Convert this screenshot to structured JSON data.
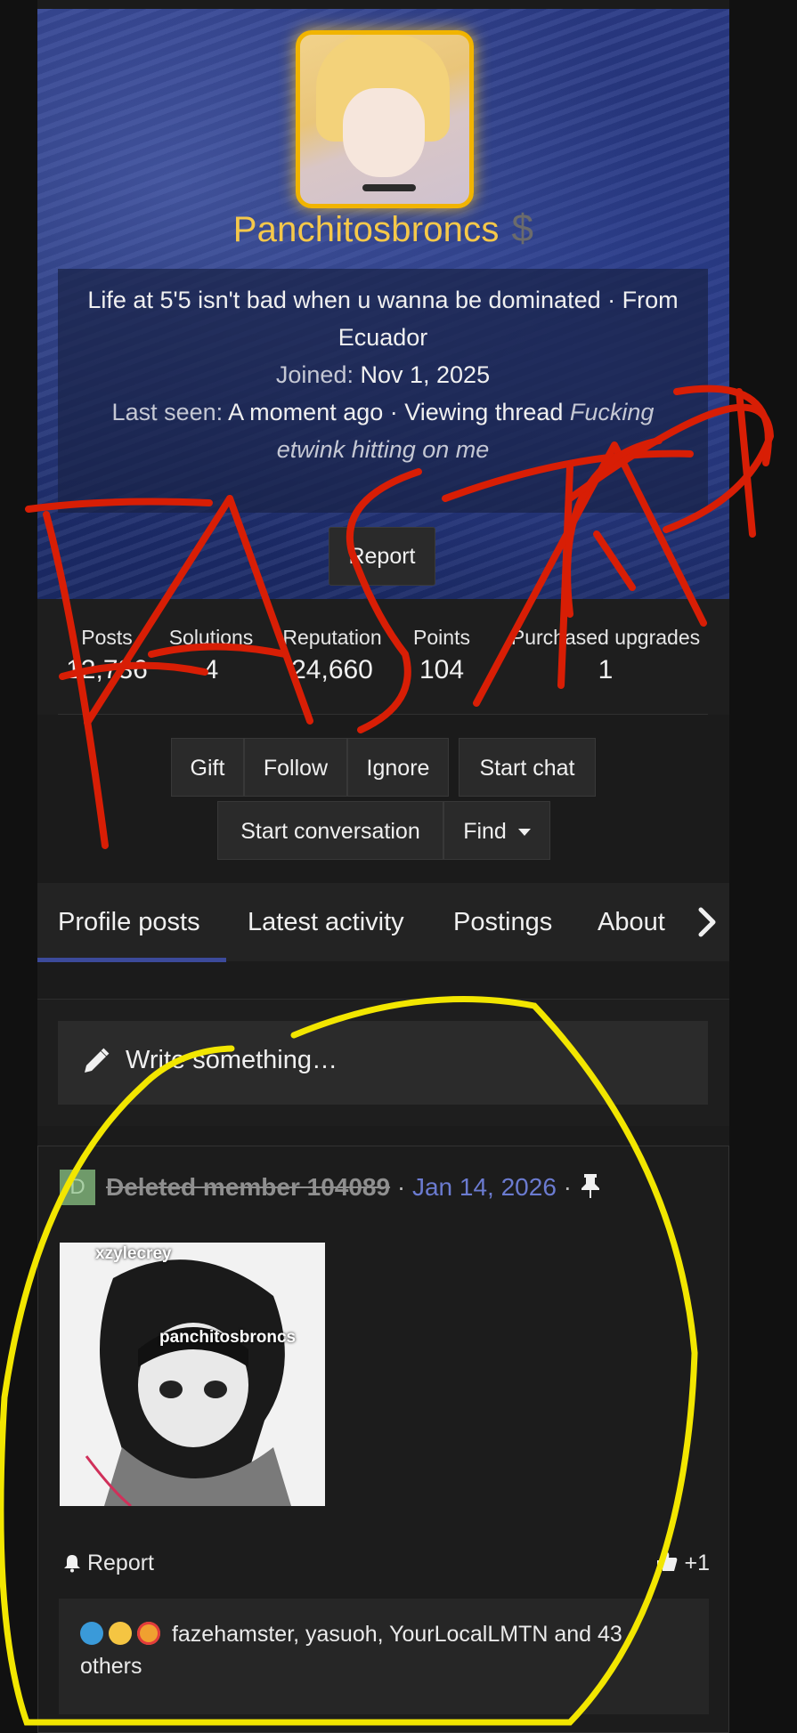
{
  "profile": {
    "username": "Panchitosbroncs",
    "badge_symbol": "$",
    "bio": "Life at 5'5 isn't bad when u wanna be dominated · From Ecuador",
    "joined_label": "Joined:",
    "joined_value": "Nov 1, 2025",
    "last_seen_label": "Last seen:",
    "last_seen_value": "A moment ago · Viewing thread",
    "last_seen_thread": "Fucking etwink hitting on me",
    "report_label": "Report"
  },
  "stats": [
    {
      "label": "Posts",
      "value": "12,736"
    },
    {
      "label": "Solutions",
      "value": "4"
    },
    {
      "label": "Reputation",
      "value": "24,660"
    },
    {
      "label": "Points",
      "value": "104"
    },
    {
      "label": "Purchased upgrades",
      "value": "1"
    }
  ],
  "actions": {
    "gift": "Gift",
    "follow": "Follow",
    "ignore": "Ignore",
    "start_chat": "Start chat",
    "start_conversation": "Start conversation",
    "find": "Find"
  },
  "tabs": [
    "Profile posts",
    "Latest activity",
    "Postings",
    "About"
  ],
  "composer": {
    "placeholder": "Write something…"
  },
  "post": {
    "avatar_letter": "D",
    "author": "Deleted member 104089",
    "date": "Jan 14, 2026",
    "image_caption_top": "xzylecrey",
    "image_caption_mid": "panchitosbroncs",
    "report_label": "Report",
    "like_count": "+1",
    "reactions_text": "fazehamster, yasuoh, YourLocalLMTN and 43 others"
  },
  "annotation": {
    "text": "FAGTARD",
    "red": "#d81e05",
    "yellow": "#f2e600"
  },
  "colors": {
    "accent": "#3c4a9a",
    "gold": "#f5c84a",
    "link": "#6b7bd0"
  }
}
